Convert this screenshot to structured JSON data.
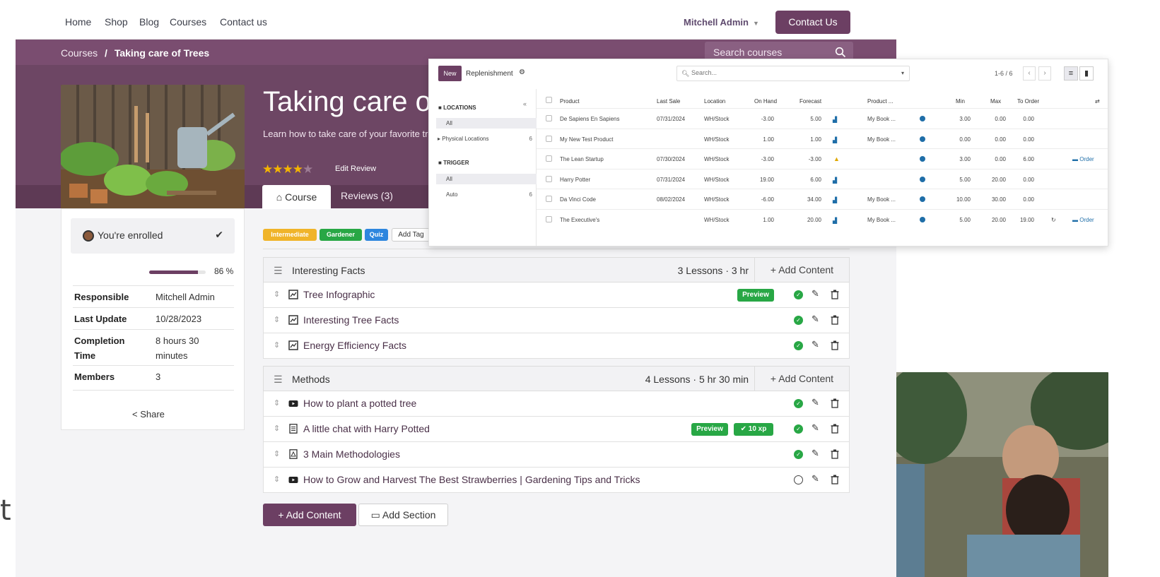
{
  "nav": {
    "links": [
      "Home",
      "Shop",
      "Blog",
      "Courses",
      "Contact us"
    ],
    "user_name": "Mitchell Admin",
    "contact_button": "Contact Us"
  },
  "breadcrumb": {
    "parent": "Courses",
    "separator": "/",
    "current": "Taking care of Trees"
  },
  "course_search": {
    "placeholder": "Search courses"
  },
  "course": {
    "title": "Taking care of Trees",
    "subtitle": "Learn how to take care of your favorite trees",
    "rating": 4,
    "edit_review": "Edit Review",
    "tab_course": "Course",
    "tab_reviews": "Reviews (3)"
  },
  "sidebar": {
    "enrolled": "You're enrolled",
    "progress_percent": 86,
    "progress_label": "86 %",
    "info": [
      {
        "key": "Responsible",
        "value": "Mitchell Admin"
      },
      {
        "key": "Last Update",
        "value": "10/28/2023"
      },
      {
        "key": "Completion Time",
        "value": "8 hours 30 minutes"
      },
      {
        "key": "Members",
        "value": "3"
      }
    ],
    "share": "Share"
  },
  "tags": [
    {
      "label": "Intermediate",
      "color": "#f0b429"
    },
    {
      "label": "Gardener",
      "color": "#28a745"
    },
    {
      "label": "Quiz",
      "color": "#2e86de"
    }
  ],
  "add_tag": "Add Tag",
  "sections": [
    {
      "title": "Interesting Facts",
      "meta": "3 Lessons · 3 hr",
      "add_content": "Add Content",
      "lessons": [
        {
          "title": "Tree Infographic",
          "icon": "infographic-icon",
          "badges": [
            "Preview"
          ],
          "done": true
        },
        {
          "title": "Interesting Tree Facts",
          "icon": "infographic-icon",
          "badges": [],
          "done": true
        },
        {
          "title": "Energy Efficiency Facts",
          "icon": "infographic-icon",
          "badges": [],
          "done": true
        }
      ]
    },
    {
      "title": "Methods",
      "meta": "4 Lessons · 5 hr 30 min",
      "add_content": "Add Content",
      "lessons": [
        {
          "title": "How to plant a potted tree",
          "icon": "video-icon",
          "badges": [],
          "done": true
        },
        {
          "title": "A little chat with Harry Potted",
          "icon": "article-icon",
          "badges": [
            "Preview",
            "✔ 10 xp"
          ],
          "done": true
        },
        {
          "title": "3 Main Methodologies",
          "icon": "pdf-icon",
          "badges": [],
          "done": true
        },
        {
          "title": "How to Grow and Harvest The Best Strawberries | Gardening Tips and Tricks",
          "icon": "video-icon",
          "badges": [],
          "done": false
        }
      ]
    }
  ],
  "footer_buttons": {
    "add_content": "+ Add Content",
    "add_section": "Add Section"
  },
  "replenishment": {
    "new_button": "New",
    "title": "Replenishment",
    "search_placeholder": "Search...",
    "pager": "1-6 / 6",
    "panel": {
      "locations_title": "LOCATIONS",
      "locations": [
        {
          "label": "All",
          "count": "",
          "active": true
        },
        {
          "label": "▸ Physical Locations",
          "count": "6",
          "active": false
        }
      ],
      "trigger_title": "TRIGGER",
      "triggers": [
        {
          "label": "All",
          "count": "",
          "active": true
        },
        {
          "label": "Auto",
          "count": "6",
          "active": false
        }
      ]
    },
    "columns": [
      "Product",
      "Last Sale",
      "Location",
      "On Hand",
      "Forecast",
      "Product ...",
      "Min",
      "Max",
      "To Order"
    ],
    "rows": [
      {
        "product": "De Sapiens En Sapiens",
        "last_sale": "07/31/2024",
        "location": "WH/Stock",
        "on_hand": "-3.00",
        "forecast": "5.00",
        "forecast_icon": "chart",
        "route": "My Book ...",
        "min": "3.00",
        "max": "0.00",
        "to_order": "0.00",
        "order": ""
      },
      {
        "product": "My New Test Product",
        "last_sale": "",
        "location": "WH/Stock",
        "on_hand": "1.00",
        "forecast": "1.00",
        "forecast_icon": "chart",
        "route": "My Book ...",
        "min": "0.00",
        "max": "0.00",
        "to_order": "0.00",
        "order": ""
      },
      {
        "product": "The Lean Startup",
        "last_sale": "07/30/2024",
        "location": "WH/Stock",
        "on_hand": "-3.00",
        "forecast": "-3.00",
        "forecast_icon": "warning",
        "route": "",
        "min": "3.00",
        "max": "0.00",
        "to_order": "6.00",
        "order": "Order"
      },
      {
        "product": "Harry Potter",
        "last_sale": "07/31/2024",
        "location": "WH/Stock",
        "on_hand": "19.00",
        "forecast": "6.00",
        "forecast_icon": "chart",
        "route": "",
        "min": "5.00",
        "max": "20.00",
        "to_order": "0.00",
        "order": ""
      },
      {
        "product": "Da Vinci Code",
        "last_sale": "08/02/2024",
        "location": "WH/Stock",
        "on_hand": "-6.00",
        "forecast": "34.00",
        "forecast_icon": "chart",
        "route": "My Book ...",
        "min": "10.00",
        "max": "30.00",
        "to_order": "0.00",
        "order": ""
      },
      {
        "product": "The Executive's",
        "last_sale": "",
        "location": "WH/Stock",
        "on_hand": "1.00",
        "forecast": "20.00",
        "forecast_icon": "chart",
        "route": "My Book ...",
        "min": "5.00",
        "max": "20.00",
        "to_order": "19.00",
        "order": "Order"
      }
    ]
  },
  "colors": {
    "brand": "#6c3f63",
    "hero": "#6d4664",
    "success": "#28a745",
    "link_blue": "#1f6ea8"
  },
  "edge_text": "t"
}
